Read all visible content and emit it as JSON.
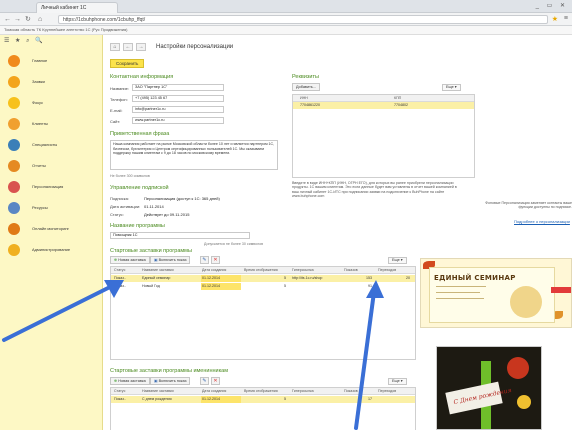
{
  "browser": {
    "tab_title": "Личный кабинет 1С",
    "url": "https://1cbuhphone.com/1cbuhp_ffqt/",
    "info": "Томская область ТК Крупнейшее агентство 1С (Рус Продвижения)",
    "window_buttons": "_ ▭ ✕"
  },
  "sidebar": {
    "tools": "☰ ★ ⌕ 🔍",
    "items": [
      {
        "label": "Главное",
        "color": "#f08a1c"
      },
      {
        "label": "Заявки",
        "color": "#f3a41c"
      },
      {
        "label": "Фокус",
        "color": "#f7c11c"
      },
      {
        "label": "Клиенты",
        "color": "#f0a030"
      },
      {
        "label": "Специалисты",
        "color": "#3b7fb8"
      },
      {
        "label": "Отчеты",
        "color": "#e58a22"
      },
      {
        "label": "Персонализация",
        "color": "#d9534f"
      },
      {
        "label": "Ресурсы",
        "color": "#5a87c4"
      },
      {
        "label": "Онлайн мониторинг",
        "color": "#e07a16"
      },
      {
        "label": "Администрирование",
        "color": "#f0b020"
      }
    ]
  },
  "main": {
    "title": "Настройки персонализации",
    "save": "Сохранить",
    "contact": {
      "section": "Контактная информация",
      "name_label": "Название:",
      "name_value": "ЗАО \"Партнер 1С\"",
      "phone_label": "Телефон:",
      "phone_value": "+7 (495) 123 45 67",
      "email_label": "E-mail:",
      "email_value": "info@partner1c.ru",
      "site_label": "Сайт:",
      "site_value": "www.partner1c.ru"
    },
    "greeting": {
      "section": "Приветственная фраза",
      "text": "Наша компания работает на рынке Московской области более 10 лет и является партнером 1С, бизнесом, бухгалтерия и Центром сертифицированных пользователей 1С. Мы оказываем поддержку нашим клиентам с 9 до 18 часов по московскому времени.",
      "limit": "Не более 300 символов"
    },
    "subscription": {
      "section": "Управление подпиской",
      "rows": [
        {
          "label": "Подписка:",
          "value": "Персонализация (доступ к 1С: 365 дней)"
        },
        {
          "label": "Дата активации:",
          "value": "01.11.2014"
        },
        {
          "label": "Статус:",
          "value": "Действует до 09.11.2015"
        }
      ]
    },
    "program": {
      "section": "Название программы",
      "value": "Помощник 1С",
      "hint": "Допускается не более 30 символов"
    },
    "requisites": {
      "section": "Реквизиты",
      "add": "Добавить...",
      "more": "Еще ▾",
      "columns": [
        "ИНН",
        "КПП"
      ],
      "row": [
        "7704861220",
        "7704802"
      ],
      "note": "Введите в виде ИНН+КПП (ИНН, ОГРН ЕГО), для которых вы ранее приобрели персонализации продукты. 1С вашим клиентам. Это если данные будет вам уставлены в отчет вашей компанией в ваш личный кабинет 1С-ИТС при подписании заявки на подключение к BuhPhone на сайте www.buhphone.com"
    },
    "right_note": {
      "text": "Фоновые Персонализация заменяет контакты ваше функции доступны по подписке.",
      "link": "Подробнее о персонализации"
    },
    "startup": {
      "section": "Стартовые заставки программы",
      "new_btn": "Новая заставка",
      "toggle_btn": "Включить показ",
      "more": "Еще ▾",
      "columns": [
        "Статус",
        "Название заставки",
        "Дата создания",
        "Время отображения",
        "Гиперссылка",
        "Показов",
        "Переходов"
      ],
      "rows": [
        [
          "Показ..",
          "Единый семинар",
          "01.12.2014",
          "5",
          "http://its.1c.ru/shop",
          "153",
          "20"
        ],
        [
          "Показ..",
          "Новый Год",
          "01.12.2014",
          "5",
          "",
          "91",
          ""
        ]
      ]
    },
    "named": {
      "section": "Стартовые заставки программы именинникам",
      "new_btn": "Новая заставка",
      "toggle_btn": "Включить показ",
      "more": "Еще ▾",
      "columns": [
        "Статус",
        "Название заставки",
        "Дата создания",
        "Время отображения",
        "Гиперссылка",
        "Показов",
        "Переходов"
      ],
      "rows": [
        [
          "Показ..",
          "С днем рождения",
          "01.12.2014",
          "5",
          "",
          "17",
          ""
        ]
      ]
    },
    "banner_title": "ЕДИНЫЙ СЕМИНАР",
    "photo_text": "С Днем рождения"
  }
}
